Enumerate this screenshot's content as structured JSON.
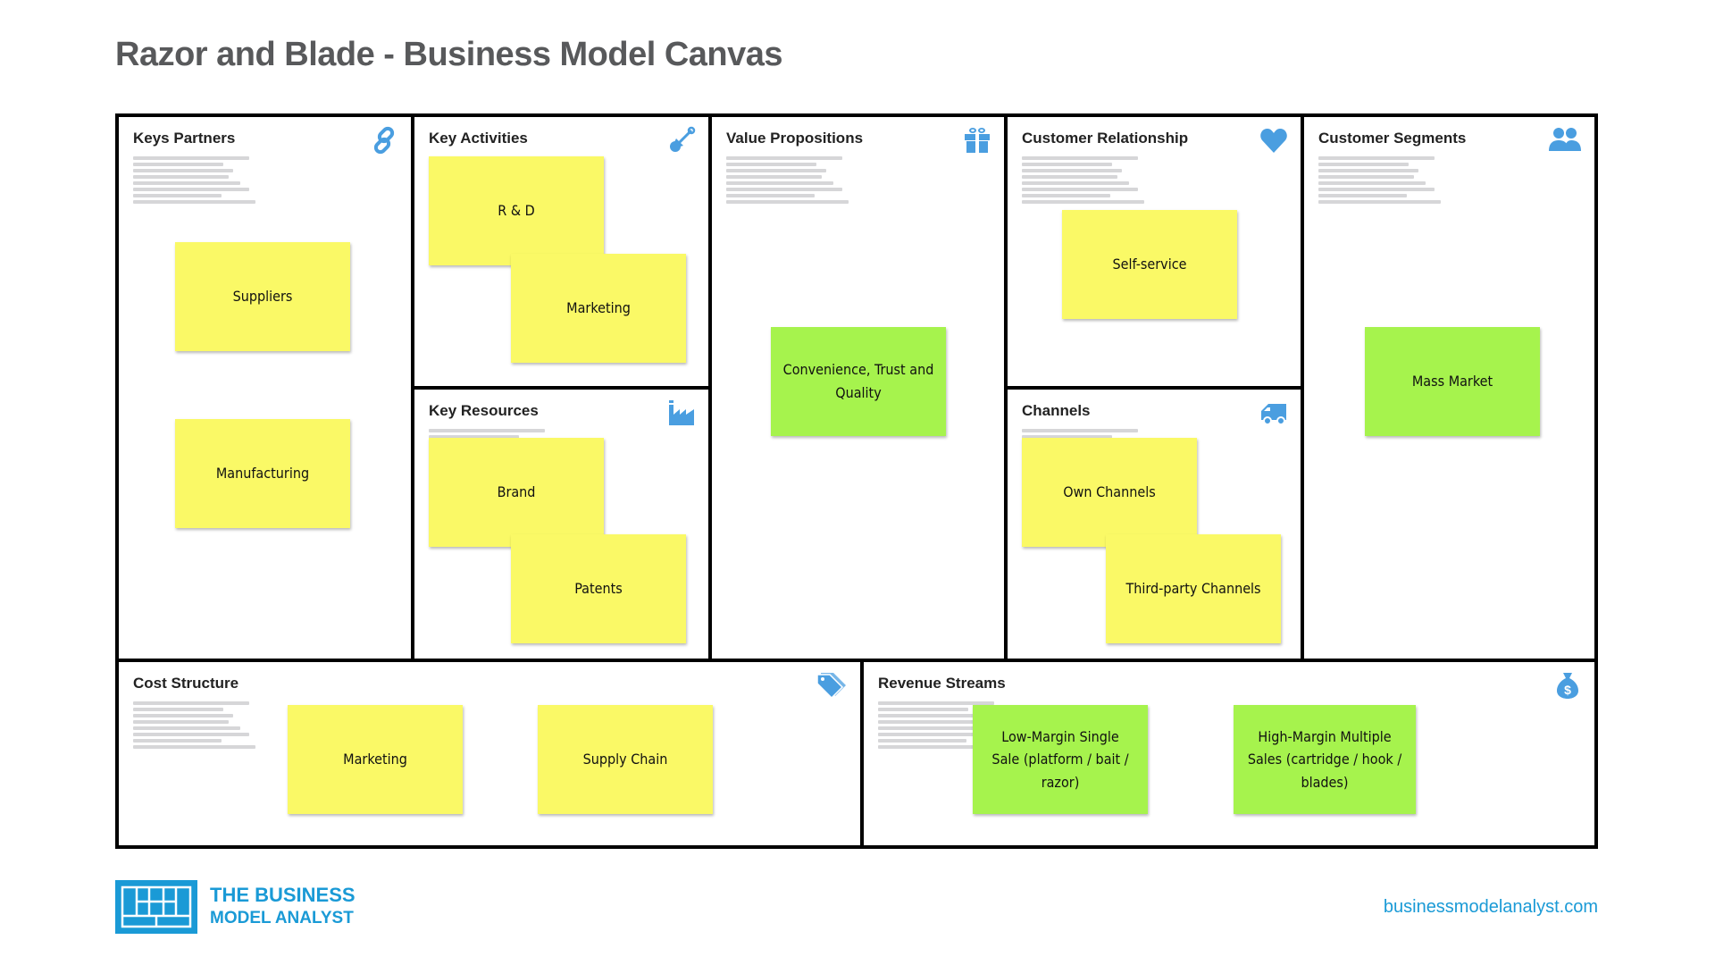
{
  "title": "Razor and Blade - Business Model Canvas",
  "colors": {
    "icon_blue": "#4a9ee0",
    "sticky_yellow": "#faf966",
    "sticky_green": "#a6f34d",
    "brand_blue": "#1a9ad6",
    "title_gray": "#58595b"
  },
  "blocks": {
    "key_partners": {
      "title": "Keys Partners",
      "icon": "link-icon",
      "notes": [
        "Suppliers",
        "Manufacturing"
      ]
    },
    "key_activities": {
      "title": "Key Activities",
      "icon": "shovel-icon",
      "notes": [
        "R & D",
        "Marketing"
      ]
    },
    "key_resources": {
      "title": "Key Resources",
      "icon": "factory-icon",
      "notes": [
        "Brand",
        "Patents"
      ]
    },
    "value_propositions": {
      "title": "Value Propositions",
      "icon": "gift-icon",
      "notes": [
        "Convenience, Trust and Quality"
      ]
    },
    "customer_relationship": {
      "title": "Customer Relationship",
      "icon": "heart-icon",
      "notes": [
        "Self-service"
      ]
    },
    "channels": {
      "title": "Channels",
      "icon": "truck-icon",
      "notes": [
        "Own Channels",
        "Third-party Channels"
      ]
    },
    "customer_segments": {
      "title": "Customer Segments",
      "icon": "users-icon",
      "notes": [
        "Mass Market"
      ]
    },
    "cost_structure": {
      "title": "Cost Structure",
      "icon": "tag-icon",
      "notes": [
        "Marketing",
        "Supply Chain"
      ]
    },
    "revenue_streams": {
      "title": "Revenue Streams",
      "icon": "money-bag-icon",
      "notes": [
        "Low-Margin Single Sale (platform / bait / razor)",
        "High-Margin Multiple Sales (cartridge / hook / blades)"
      ]
    }
  },
  "footer": {
    "logo_line1": "THE BUSINESS",
    "logo_line2": "MODEL ANALYST",
    "url": "businessmodelanalyst.com"
  }
}
